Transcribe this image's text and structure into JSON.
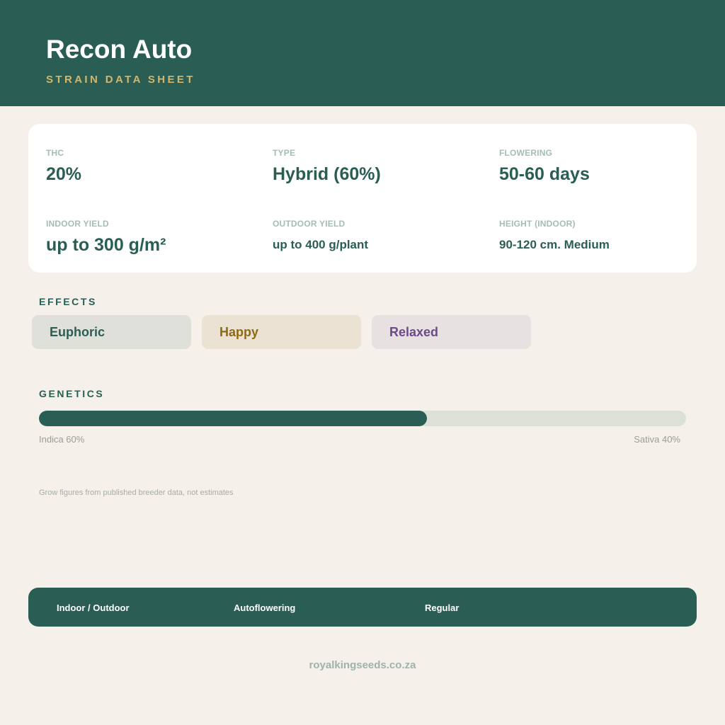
{
  "header": {
    "title": "Recon Auto",
    "subtitle": "STRAIN DATA SHEET"
  },
  "stats": [
    {
      "label": "THC",
      "value": "20%"
    },
    {
      "label": "TYPE",
      "value": "Hybrid (60%)"
    },
    {
      "label": "FLOWERING",
      "value": "50-60 days"
    },
    {
      "label": "INDOOR YIELD",
      "value": "up to 300 g/m²"
    },
    {
      "label": "OUTDOOR YIELD",
      "value": "up to 400 g/plant"
    },
    {
      "label": "HEIGHT (INDOOR)",
      "value": "90-120 cm. Medium"
    }
  ],
  "effects": {
    "heading": "EFFECTS",
    "items": [
      {
        "label": "Euphoric",
        "text_color": "#2a5e55",
        "bg_color": "#dfe0d9"
      },
      {
        "label": "Happy",
        "text_color": "#8f6a14",
        "bg_color": "#ece2d3"
      },
      {
        "label": "Relaxed",
        "text_color": "#6b4a8c",
        "bg_color": "#e7e1e1"
      }
    ]
  },
  "genetics": {
    "heading": "GENETICS",
    "indica_fraction": 0.6,
    "indica_label": "Indica 60%",
    "sativa_label": "Sativa 40%"
  },
  "footnote": "Grow figures from published breeder data, not estimates",
  "footer_tags": [
    "Indoor / Outdoor",
    "Autoflowering",
    "Regular"
  ],
  "website": "royalkingseeds.co.za",
  "colors": {
    "primary": "#2a5e55",
    "accent": "#d4b66a",
    "background": "#f5f0ea",
    "muted_label": "#a6bcb6"
  }
}
